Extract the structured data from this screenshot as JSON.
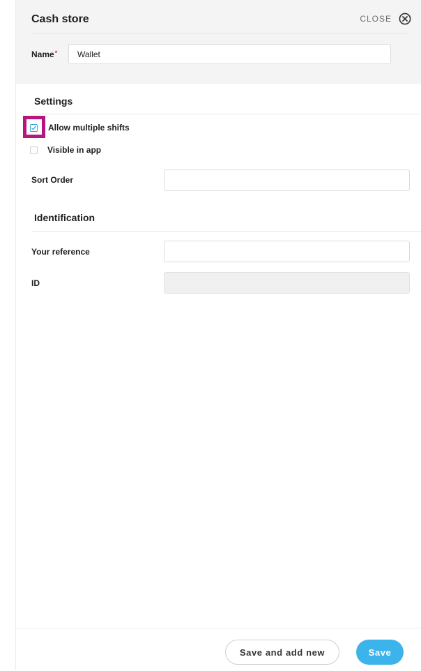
{
  "header": {
    "title": "Cash store",
    "close_label": "CLOSE",
    "name_label": "Name",
    "name_required_mark": "*",
    "name_value": "Wallet"
  },
  "settings": {
    "title": "Settings",
    "allow_multiple_shifts": {
      "label": "Allow multiple shifts",
      "checked": true
    },
    "visible_in_app": {
      "label": "Visible in app",
      "checked": false
    },
    "sort_order": {
      "label": "Sort Order",
      "value": ""
    }
  },
  "identification": {
    "title": "Identification",
    "your_reference": {
      "label": "Your reference",
      "value": ""
    },
    "id": {
      "label": "ID",
      "value": ""
    }
  },
  "footer": {
    "save_and_add_new_label": "Save and add new",
    "save_label": "Save"
  },
  "colors": {
    "accent": "#3cb3ea",
    "highlight": "#b5177e",
    "header_bg": "#f4f4f4"
  }
}
